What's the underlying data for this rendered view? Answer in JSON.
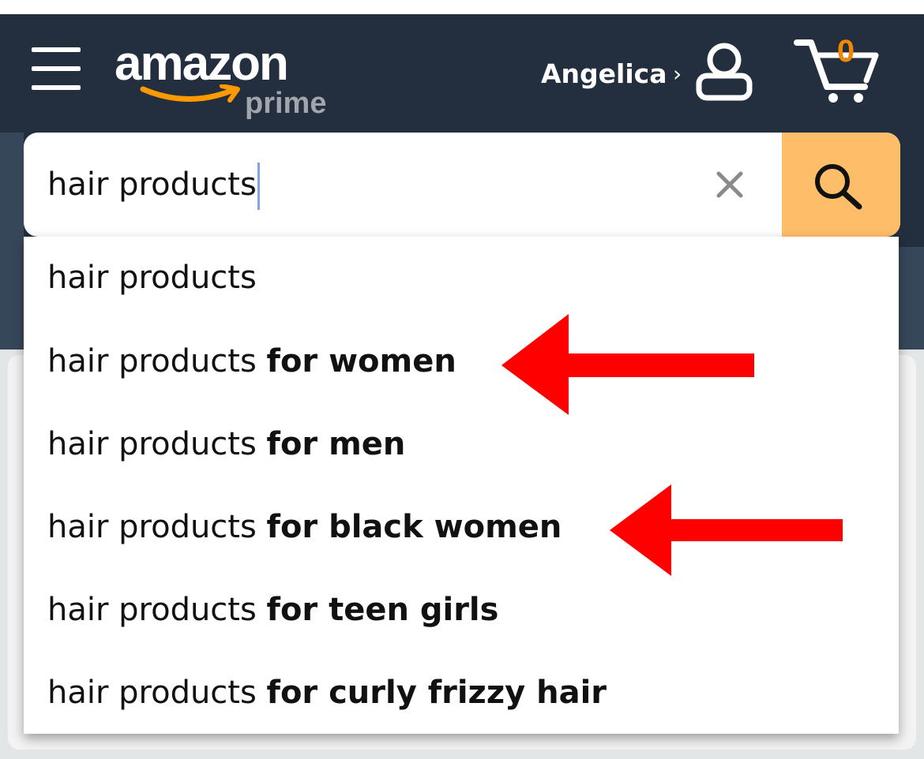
{
  "header": {
    "logo_text": "amazon",
    "logo_sub": "prime",
    "account_name": "Angelica",
    "account_chevron": "›",
    "cart_count": "0"
  },
  "search": {
    "value": "hair products",
    "clear_glyph": "×"
  },
  "suggestions": [
    {
      "prefix": "hair products",
      "completion": ""
    },
    {
      "prefix": "hair products ",
      "completion": "for women"
    },
    {
      "prefix": "hair products ",
      "completion": "for men"
    },
    {
      "prefix": "hair products ",
      "completion": "for black women"
    },
    {
      "prefix": "hair products ",
      "completion": "for teen girls"
    },
    {
      "prefix": "hair products ",
      "completion": "for curly frizzy hair"
    }
  ],
  "annotations": {
    "arrow_color": "#ff0000",
    "arrows_point_to": [
      "for women",
      "for black women"
    ]
  },
  "colors": {
    "header_bg": "#232f3e",
    "search_button_bg": "#febd69",
    "cart_count": "#f08804",
    "logo_smile": "#ff9900"
  },
  "icons": {
    "menu": "hamburger-menu-icon",
    "account": "user-icon",
    "cart": "cart-icon",
    "clear": "clear-icon",
    "search": "search-icon"
  }
}
